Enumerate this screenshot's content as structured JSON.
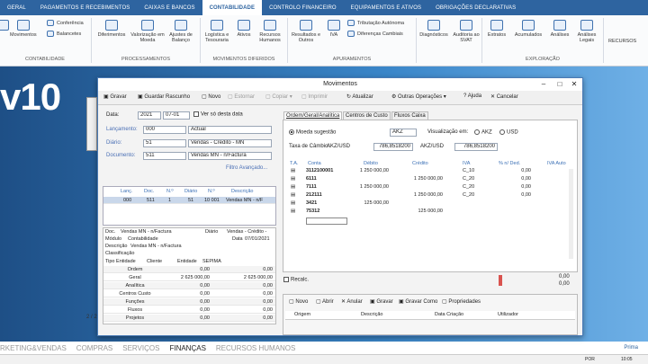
{
  "tabs": [
    "GERAL",
    "PAGAMENTOS E RECEBIMENTOS",
    "CAIXAS E BANCOS",
    "CONTABILIDADE",
    "CONTROLO FINANCEIRO",
    "EQUIPAMENTOS E ATIVOS",
    "OBRIGAÇÕES DECLARATIVAS"
  ],
  "ribbon": {
    "movimentos": "Movimentos",
    "conferencia": "Conferência",
    "balancetes": "Balancetes",
    "diferimentos": "Diferimentos",
    "valorizacao": "Valorização em Moeda",
    "ajustes": "Ajustes de Balanço",
    "logistica": "Logística e Tesouraria",
    "ativos": "Ativos",
    "recursos_humanos": "Recursos Humanos",
    "resultados": "Resultados e Outros",
    "iva": "IVA",
    "tributacao": "Tributação Autónoma",
    "diferencas": "Diferenças Cambiais",
    "diagnosticos": "Diagnósticos",
    "auditoria": "Auditoria ao SVAT",
    "extratos": "Extratos",
    "acumulados": "Acumulados",
    "analises": "Análises",
    "analises_legais": "Análises Legais",
    "recursos": "RECURSOS",
    "groups": [
      "CONTABILIDADE",
      "PROCESSAMENTOS",
      "MOVIMENTOS DIFERIDOS",
      "APURAMENTOS",
      "EXPLORAÇÃO"
    ]
  },
  "brand": "v10",
  "bottom_menu": [
    "RKETING&VENDAS",
    "COMPRAS",
    "SERVIÇOS",
    "FINANÇAS",
    "RECURSOS HUMANOS"
  ],
  "bottom_right": "Prima",
  "taskbar": {
    "lang": "POR",
    "time": "10:05"
  },
  "window": {
    "title": "Movimentos",
    "toolbar": [
      "Gravar",
      "Guardar Rascunho",
      "Novo",
      "Estornar",
      "Copiar",
      "Imprimir",
      "Atualizar",
      "Outras Operações",
      "Ajuda",
      "Cancelar"
    ],
    "left": {
      "data_label": "Data:",
      "year": "2021",
      "date": "07-01",
      "ver_label": "Ver só desta data",
      "lancamento_label": "Lançamento:",
      "lancamento_code": "000",
      "lancamento_desc": "Actual",
      "diario_label": "Diário:",
      "diario_code": "51",
      "diario_desc": "Vendas - Crédito - MN",
      "documento_label": "Documento:",
      "documento_code": "511",
      "documento_desc": "Vendas MN - n/Factura",
      "filtro": "Filtro Avançado...",
      "grid_headers": [
        "Lanç.",
        "Doc.",
        "N.º",
        "Diário",
        "N.º",
        "Descrição"
      ],
      "grid_row": [
        "000",
        "511",
        "1",
        "51",
        "10 001",
        "Vendas MN - n/F"
      ],
      "info": {
        "doc_label": "Doc.",
        "doc_val": "Vendas MN - n/Factura",
        "diario_label": "Diário",
        "diario_val": "Vendas - Crédito -",
        "modulo_label": "Módulo",
        "modulo_val": "Contabilidade",
        "data_label": "Data",
        "data_val": "07/01/2021",
        "descricao_label": "Descrição",
        "descricao_val": "Vendas MN - n/Factura",
        "classificacao": "Classificação",
        "tipo_label": "Tipo Entidade",
        "cliente": "Cliente",
        "entidade": "Entidade",
        "entidade_val": "SEPIMA"
      },
      "summary": [
        [
          "Ordem",
          "0,00",
          "0,00"
        ],
        [
          "Geral",
          "2 625 000,00",
          "2 625 000,00"
        ],
        [
          "Analítica",
          "0,00",
          "0,00"
        ],
        [
          "Centros Custo",
          "0,00",
          "0,00"
        ],
        [
          "Funções",
          "0,00",
          "0,00"
        ],
        [
          "Fluxos",
          "0,00",
          "0,00"
        ],
        [
          "Projetos",
          "0,00",
          "0,00"
        ]
      ],
      "pager": "2 / 2"
    },
    "right": {
      "tabs": [
        "Ordem/Geral/Analítica",
        "Centros de Custo",
        "Fluxos Caixa"
      ],
      "moeda_label": "Moeda sugestão",
      "moeda_val": "AKZ",
      "visualizacao_label": "Visualização em:",
      "akz": "AKZ",
      "usd": "USD",
      "taxa_label": "Taxa de Câmbio:",
      "taxa_pair1": "AKZ/USD",
      "taxa_val1": "786,8518200",
      "taxa_pair2": "AKZ/USD",
      "taxa_val2": "786,8518200",
      "grid_headers": [
        "T.A.",
        "Conta",
        "Débito",
        "Crédito",
        "IVA",
        "% n/ Ded.",
        "IVA Auto"
      ],
      "rows": [
        {
          "conta": "3112100001",
          "debito": "1 250 000,00",
          "credito": "",
          "iva": "C_10",
          "ded": "0,00"
        },
        {
          "conta": "6111",
          "debito": "",
          "credito": "1 250 000,00",
          "iva": "C_20",
          "ded": "0,00"
        },
        {
          "conta": "7111",
          "debito": "1 250 000,00",
          "credito": "",
          "iva": "C_20",
          "ded": "0,00"
        },
        {
          "conta": "212111",
          "debito": "",
          "credito": "1 250 000,00",
          "iva": "C_20",
          "ded": "0,00"
        },
        {
          "conta": "3421",
          "debito": "125 000,00",
          "credito": "",
          "iva": "",
          "ded": ""
        },
        {
          "conta": "75312",
          "debito": "",
          "credito": "125 000,00",
          "iva": "",
          "ded": ""
        }
      ],
      "recalc": "Recalc.",
      "totals": [
        "0,00",
        "0,00"
      ],
      "attach_buttons": [
        "Novo",
        "Abrir",
        "Anular",
        "Gravar",
        "Gravar Como",
        "Propriedades"
      ],
      "attach_headers": [
        "Origem",
        "Descrição",
        "Data Criação",
        "Utilizador"
      ]
    }
  },
  "colors": {
    "tabbar": "#2e64a0",
    "brand_bg": "#3a86c9"
  }
}
